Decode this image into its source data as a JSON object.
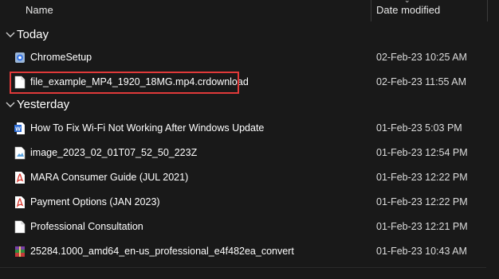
{
  "columns": {
    "name": "Name",
    "date_modified": "Date modified"
  },
  "groups": [
    {
      "label": "Today",
      "items": [
        {
          "name": "ChromeSetup",
          "date": "02-Feb-23 10:25 AM",
          "icon": "chrome-setup-icon"
        },
        {
          "name": "file_example_MP4_1920_18MG.mp4.crdownload",
          "date": "02-Feb-23 11:55 AM",
          "icon": "blank-file-icon",
          "highlighted": true
        }
      ]
    },
    {
      "label": "Yesterday",
      "items": [
        {
          "name": "How To Fix Wi-Fi Not Working After Windows Update",
          "date": "01-Feb-23 5:03 PM",
          "icon": "word-document-icon"
        },
        {
          "name": "image_2023_02_01T07_52_50_223Z",
          "date": "01-Feb-23 12:54 PM",
          "icon": "image-file-icon"
        },
        {
          "name": "MARA Consumer Guide (JUL 2021)",
          "date": "01-Feb-23 12:22 PM",
          "icon": "pdf-icon"
        },
        {
          "name": "Payment Options (JAN 2023)",
          "date": "01-Feb-23 12:22 PM",
          "icon": "pdf-icon"
        },
        {
          "name": "Professional Consultation",
          "date": "01-Feb-23 12:21 PM",
          "icon": "blank-file-icon"
        },
        {
          "name": "25284.1000_amd64_en-us_professional_e4f482ea_convert",
          "date": "01-Feb-23 10:43 AM",
          "icon": "winrar-archive-icon"
        }
      ]
    }
  ],
  "colors": {
    "highlight_border": "#e03a3a",
    "background": "#191919",
    "pdf_red": "#d9342b",
    "word_blue": "#2b6cd6"
  }
}
